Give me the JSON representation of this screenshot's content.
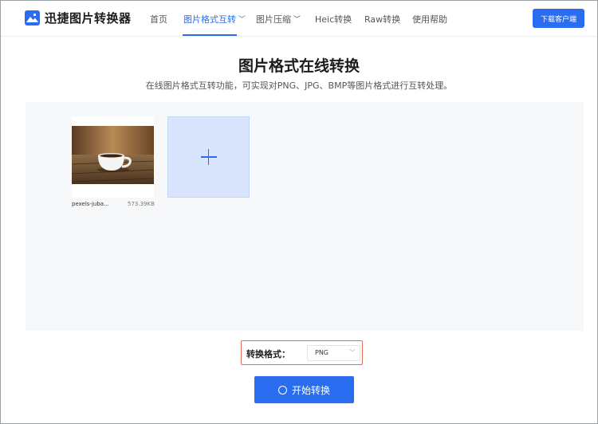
{
  "header": {
    "app_title": "迅捷图片转换器",
    "nav": [
      {
        "label": "首页"
      },
      {
        "label": "图片格式互转"
      },
      {
        "label": "图片压缩"
      },
      {
        "label": "Heic转换"
      },
      {
        "label": "Raw转换"
      },
      {
        "label": "使用帮助"
      }
    ],
    "download_button": "下载客户端",
    "active_color": "#2a6df0"
  },
  "main": {
    "title": "图片格式在线转换",
    "subtitle": "在线图片格式互转功能，可实现对PNG、JPG、BMP等图片格式进行互转处理。",
    "files": [
      {
        "name": "pexels-juba...",
        "size": "573.39KB"
      }
    ],
    "add_icon": "plus-icon"
  },
  "convert": {
    "format_label": "转换格式：",
    "format_value": "PNG",
    "start_button": "开始转换"
  }
}
